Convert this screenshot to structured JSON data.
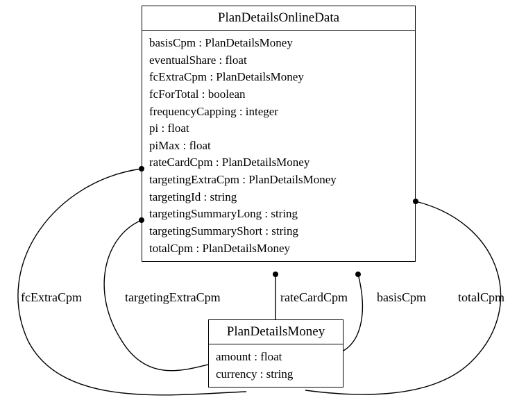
{
  "classes": {
    "planDetailsOnlineData": {
      "name": "PlanDetailsOnlineData",
      "attributes": [
        "basisCpm : PlanDetailsMoney",
        "eventualShare : float",
        "fcExtraCpm : PlanDetailsMoney",
        "fcForTotal : boolean",
        "frequencyCapping : integer",
        "pi : float",
        "piMax : float",
        "rateCardCpm : PlanDetailsMoney",
        "targetingExtraCpm : PlanDetailsMoney",
        "targetingId : string",
        "targetingSummaryLong : string",
        "targetingSummaryShort : string",
        "totalCpm : PlanDetailsMoney"
      ]
    },
    "planDetailsMoney": {
      "name": "PlanDetailsMoney",
      "attributes": [
        "amount : float",
        "currency : string"
      ]
    }
  },
  "associations": {
    "fcExtraCpm": "fcExtraCpm",
    "targetingExtraCpm": "targetingExtraCpm",
    "rateCardCpm": "rateCardCpm",
    "basisCpm": "basisCpm",
    "totalCpm": "totalCpm"
  }
}
